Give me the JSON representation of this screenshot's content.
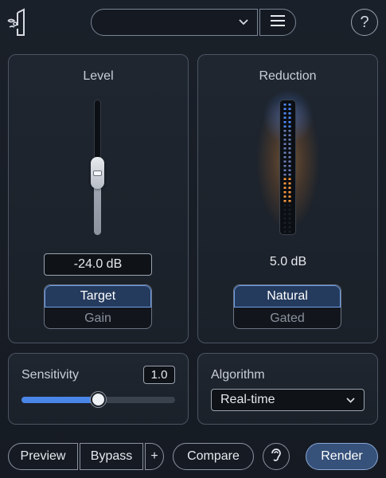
{
  "header": {
    "logo_icon": "headphones-logo-icon",
    "preset_value": "",
    "menu_icon": "hamburger-menu-icon",
    "help_label": "?"
  },
  "level_panel": {
    "title": "Level",
    "slider_level": 0.45,
    "value": "-24.0 dB",
    "mode_options": [
      "Target",
      "Gain"
    ],
    "selected_mode": "Target"
  },
  "reduction_panel": {
    "title": "Reduction",
    "value": "5.0 dB",
    "meter_fill": 0.55,
    "mode_options": [
      "Natural",
      "Gated"
    ],
    "selected_mode": "Natural"
  },
  "sensitivity": {
    "label": "Sensitivity",
    "value": "1.0",
    "slider_level": 0.5
  },
  "algorithm": {
    "label": "Algorithm",
    "selected": "Real-time"
  },
  "footer": {
    "preview_label": "Preview",
    "bypass_label": "Bypass",
    "add_label": "+",
    "compare_label": "Compare",
    "listen_icon": "ear-icon",
    "render_label": "Render"
  },
  "colors": {
    "accent": "#4a86e8",
    "meter_blue": "#4f8cff",
    "meter_orange": "#ff9a3c"
  }
}
